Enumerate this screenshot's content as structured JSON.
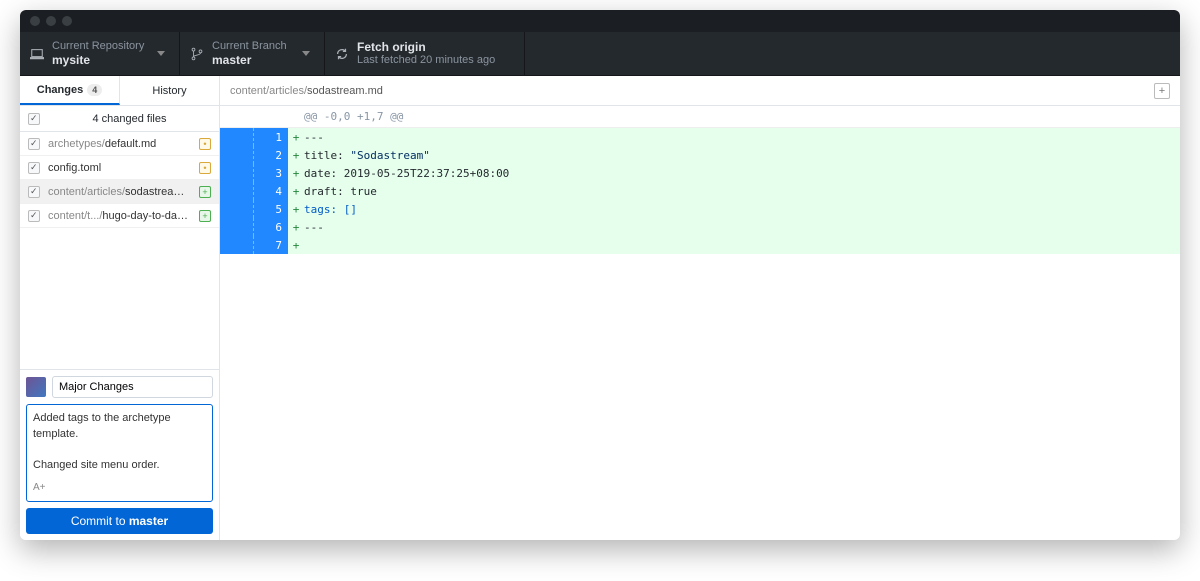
{
  "toolbar": {
    "repo_label": "Current Repository",
    "repo_value": "mysite",
    "branch_label": "Current Branch",
    "branch_value": "master",
    "fetch_label": "Fetch origin",
    "fetch_sub": "Last fetched 20 minutes ago"
  },
  "sidebar": {
    "tab_changes": "Changes",
    "tab_changes_count": "4",
    "tab_history": "History",
    "summary": "4 changed files",
    "files": [
      {
        "dir": "archetypes/",
        "name": "default.md",
        "status": "M",
        "glyph": "•"
      },
      {
        "dir": "",
        "name": "config.toml",
        "status": "M",
        "glyph": "•"
      },
      {
        "dir": "content/articles/",
        "name": "sodastream.md",
        "status": "A",
        "glyph": "+"
      },
      {
        "dir": "content/t.../",
        "name": "hugo-day-to-day.md",
        "status": "A",
        "glyph": "+"
      }
    ]
  },
  "commit": {
    "summary_value": "Major Changes",
    "description_value": "Added tags to the archetype template.\n\nChanged site menu order.",
    "coauthor_hint": "A+",
    "button_prefix": "Commit to ",
    "button_branch": "master"
  },
  "diff": {
    "file_dir": "content/articles/",
    "file_name": "sodastream.md",
    "hunk": "@@ -0,0 +1,7 @@",
    "lines": [
      {
        "n": "1",
        "text": "---",
        "type": "plain"
      },
      {
        "n": "2",
        "text": "title: \"Sodastream\"",
        "type": "kv"
      },
      {
        "n": "3",
        "text": "date: 2019-05-25T22:37:25+08:00",
        "type": "kv"
      },
      {
        "n": "4",
        "text": "draft: true",
        "type": "kv"
      },
      {
        "n": "5",
        "text": "tags: []",
        "type": "tags"
      },
      {
        "n": "6",
        "text": "---",
        "type": "plain"
      },
      {
        "n": "7",
        "text": "",
        "type": "plain"
      }
    ]
  }
}
